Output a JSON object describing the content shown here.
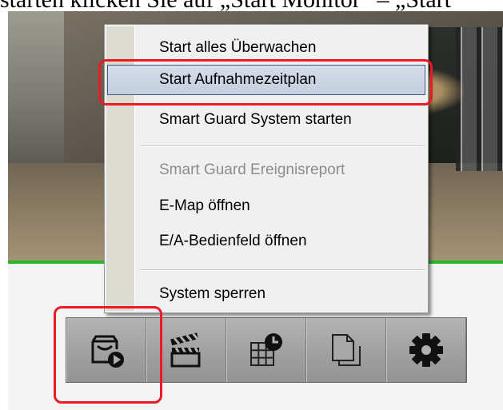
{
  "document": {
    "top_text": "starten klicken Sie auf „Start Monitor“ – „Start"
  },
  "context_menu": {
    "items": [
      {
        "label": "Start alles Überwachen",
        "enabled": true,
        "selected": false
      },
      {
        "label": "Start Aufnahmezeitplan",
        "enabled": true,
        "selected": true
      },
      {
        "label": "Smart Guard System starten",
        "enabled": true,
        "selected": false
      },
      {
        "label": "Smart Guard Ereignisreport",
        "enabled": false,
        "selected": false
      },
      {
        "label": "E-Map öffnen",
        "enabled": true,
        "selected": false
      },
      {
        "label": "E/A-Bedienfeld öffnen",
        "enabled": true,
        "selected": false
      },
      {
        "label": "System sperren",
        "enabled": true,
        "selected": false
      }
    ]
  },
  "toolbar": {
    "buttons": [
      {
        "icon": "start-monitor-icon",
        "highlighted": true
      },
      {
        "icon": "clapperboard-icon",
        "highlighted": false
      },
      {
        "icon": "schedule-icon",
        "highlighted": false
      },
      {
        "icon": "documents-icon",
        "highlighted": false
      },
      {
        "icon": "gear-icon",
        "highlighted": false
      }
    ]
  },
  "colors": {
    "highlight": "#ea1b23",
    "video_border": "#27b727",
    "menu_selection_border": "#3d5a8a"
  }
}
